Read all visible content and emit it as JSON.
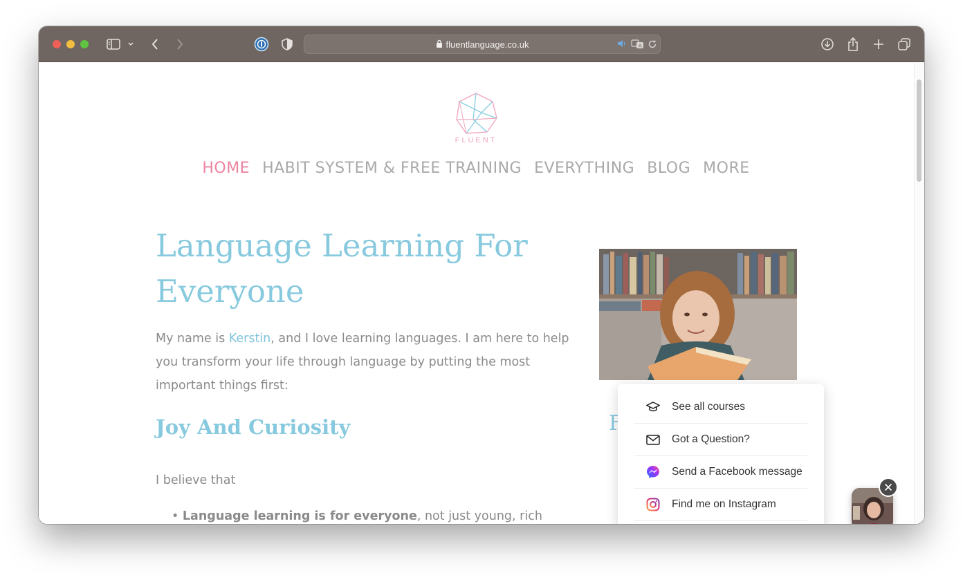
{
  "browser": {
    "url": "fluentlanguage.co.uk",
    "accent": "#6f6661"
  },
  "logo": {
    "text": "FLUENT"
  },
  "nav": {
    "items": [
      {
        "label": "HOME",
        "active": true
      },
      {
        "label": "HABIT SYSTEM & FREE TRAINING"
      },
      {
        "label": "EVERYTHING"
      },
      {
        "label": "BLOG"
      },
      {
        "label": "MORE"
      }
    ]
  },
  "hero": {
    "title": "Language Learning For Everyone",
    "intro_before": "My name is ",
    "intro_link": "Kerstin",
    "intro_after": ", and I love learning languages. I am here to help you transform your life through language by putting the most important things first:",
    "subtitle": "Joy And Curiosity",
    "paragraph": "I believe that",
    "bullet_bold": "Language learning is for everyone",
    "bullet_rest": ", not just young, rich"
  },
  "sidebar": {
    "partial_heading": "F"
  },
  "popup": {
    "items": [
      {
        "label": "See all courses",
        "icon": "graduation-cap-icon"
      },
      {
        "label": "Got a Question?",
        "icon": "envelope-icon"
      },
      {
        "label": "Send a Facebook message",
        "icon": "messenger-icon"
      },
      {
        "label": "Find me on Instagram",
        "icon": "instagram-icon"
      }
    ]
  },
  "colors": {
    "title_blue": "#87c9de",
    "nav_pink": "#ec84a0",
    "body_gray": "#8a8a8a"
  }
}
